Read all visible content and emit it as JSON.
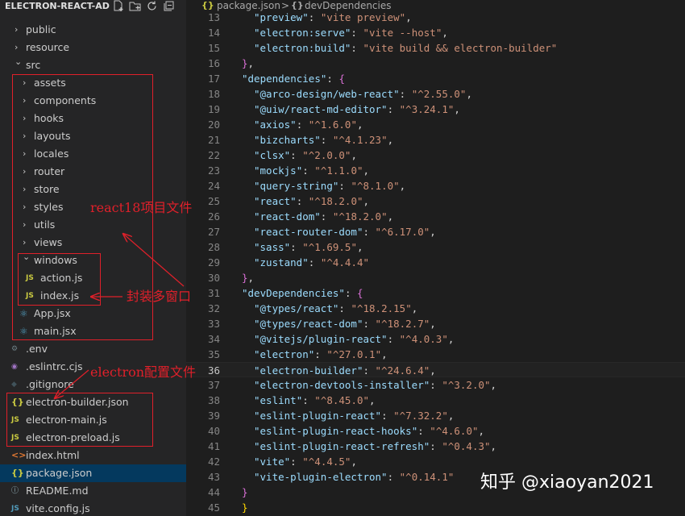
{
  "explorer": {
    "title": "ELECTRON-REACT-AD...",
    "actions": [
      {
        "name": "new-file-icon"
      },
      {
        "name": "new-folder-icon"
      },
      {
        "name": "refresh-icon"
      },
      {
        "name": "collapse-all-icon"
      }
    ],
    "tree": [
      {
        "label": "public",
        "type": "folder",
        "depth": 1,
        "expanded": false
      },
      {
        "label": "resource",
        "type": "folder",
        "depth": 1,
        "expanded": false
      },
      {
        "label": "src",
        "type": "folder",
        "depth": 1,
        "expanded": true
      },
      {
        "label": "assets",
        "type": "folder",
        "depth": 2,
        "expanded": false
      },
      {
        "label": "components",
        "type": "folder",
        "depth": 2,
        "expanded": false
      },
      {
        "label": "hooks",
        "type": "folder",
        "depth": 2,
        "expanded": false
      },
      {
        "label": "layouts",
        "type": "folder",
        "depth": 2,
        "expanded": false
      },
      {
        "label": "locales",
        "type": "folder",
        "depth": 2,
        "expanded": false
      },
      {
        "label": "router",
        "type": "folder",
        "depth": 2,
        "expanded": false
      },
      {
        "label": "store",
        "type": "folder",
        "depth": 2,
        "expanded": false
      },
      {
        "label": "styles",
        "type": "folder",
        "depth": 2,
        "expanded": false
      },
      {
        "label": "utils",
        "type": "folder",
        "depth": 2,
        "expanded": false
      },
      {
        "label": "views",
        "type": "folder",
        "depth": 2,
        "expanded": false
      },
      {
        "label": "windows",
        "type": "folder",
        "depth": 2,
        "expanded": true
      },
      {
        "label": "action.js",
        "type": "js",
        "icon": "JS",
        "depth": 3
      },
      {
        "label": "index.js",
        "type": "js",
        "icon": "JS",
        "depth": 3
      },
      {
        "label": "App.jsx",
        "type": "jsx",
        "icon": "⚛",
        "depth": 2
      },
      {
        "label": "main.jsx",
        "type": "jsx",
        "icon": "⚛",
        "depth": 2
      },
      {
        "label": ".env",
        "type": "env",
        "icon": "⚙",
        "depth": 1
      },
      {
        "label": ".eslintrc.cjs",
        "type": "eslint",
        "icon": "◉",
        "depth": 1
      },
      {
        "label": ".gitignore",
        "type": "git",
        "icon": "◆",
        "depth": 1
      },
      {
        "label": "electron-builder.json",
        "type": "json",
        "icon": "{}",
        "depth": 1
      },
      {
        "label": "electron-main.js",
        "type": "js",
        "icon": "JS",
        "depth": 1
      },
      {
        "label": "electron-preload.js",
        "type": "js",
        "icon": "JS",
        "depth": 1
      },
      {
        "label": "index.html",
        "type": "html",
        "icon": "<>",
        "depth": 1
      },
      {
        "label": "package.json",
        "type": "json",
        "icon": "{}",
        "depth": 1,
        "selected": true
      },
      {
        "label": "README.md",
        "type": "info",
        "icon": "ⓘ",
        "depth": 1
      },
      {
        "label": "vite.config.js",
        "type": "vite",
        "icon": "JS",
        "depth": 1
      }
    ]
  },
  "breadcrumb": {
    "icon": "{}",
    "file": "package.json",
    "separator": ">",
    "symbol_icon": "{}",
    "symbol": "devDependencies"
  },
  "editor": {
    "current_line": 36,
    "lines": [
      {
        "n": 13,
        "indent": 2,
        "key": "preview",
        "value": "vite preview",
        "tail": ","
      },
      {
        "n": 14,
        "indent": 2,
        "key": "electron:serve",
        "value": "vite --host",
        "tail": ","
      },
      {
        "n": 15,
        "indent": 2,
        "key": "electron:build",
        "value": "vite build && electron-builder",
        "tail": ""
      },
      {
        "n": 16,
        "indent": 1,
        "close": "}",
        "tail": ","
      },
      {
        "n": 17,
        "indent": 1,
        "key": "dependencies",
        "open": "{"
      },
      {
        "n": 18,
        "indent": 2,
        "key": "@arco-design/web-react",
        "value": "^2.55.0",
        "tail": ","
      },
      {
        "n": 19,
        "indent": 2,
        "key": "@uiw/react-md-editor",
        "value": "^3.24.1",
        "tail": ","
      },
      {
        "n": 20,
        "indent": 2,
        "key": "axios",
        "value": "^1.6.0",
        "tail": ","
      },
      {
        "n": 21,
        "indent": 2,
        "key": "bizcharts",
        "value": "^4.1.23",
        "tail": ","
      },
      {
        "n": 22,
        "indent": 2,
        "key": "clsx",
        "value": "^2.0.0",
        "tail": ","
      },
      {
        "n": 23,
        "indent": 2,
        "key": "mockjs",
        "value": "^1.1.0",
        "tail": ","
      },
      {
        "n": 24,
        "indent": 2,
        "key": "query-string",
        "value": "^8.1.0",
        "tail": ","
      },
      {
        "n": 25,
        "indent": 2,
        "key": "react",
        "value": "^18.2.0",
        "tail": ","
      },
      {
        "n": 26,
        "indent": 2,
        "key": "react-dom",
        "value": "^18.2.0",
        "tail": ","
      },
      {
        "n": 27,
        "indent": 2,
        "key": "react-router-dom",
        "value": "^6.17.0",
        "tail": ","
      },
      {
        "n": 28,
        "indent": 2,
        "key": "sass",
        "value": "^1.69.5",
        "tail": ","
      },
      {
        "n": 29,
        "indent": 2,
        "key": "zustand",
        "value": "^4.4.4",
        "tail": ""
      },
      {
        "n": 30,
        "indent": 1,
        "close": "}",
        "tail": ","
      },
      {
        "n": 31,
        "indent": 1,
        "key": "devDependencies",
        "open": "{"
      },
      {
        "n": 32,
        "indent": 2,
        "key": "@types/react",
        "value": "^18.2.15",
        "tail": ","
      },
      {
        "n": 33,
        "indent": 2,
        "key": "@types/react-dom",
        "value": "^18.2.7",
        "tail": ","
      },
      {
        "n": 34,
        "indent": 2,
        "key": "@vitejs/plugin-react",
        "value": "^4.0.3",
        "tail": ","
      },
      {
        "n": 35,
        "indent": 2,
        "key": "electron",
        "value": "^27.0.1",
        "tail": ","
      },
      {
        "n": 36,
        "indent": 2,
        "key": "electron-builder",
        "value": "^24.6.4",
        "tail": ","
      },
      {
        "n": 37,
        "indent": 2,
        "key": "electron-devtools-installer",
        "value": "^3.2.0",
        "tail": ","
      },
      {
        "n": 38,
        "indent": 2,
        "key": "eslint",
        "value": "^8.45.0",
        "tail": ","
      },
      {
        "n": 39,
        "indent": 2,
        "key": "eslint-plugin-react",
        "value": "^7.32.2",
        "tail": ","
      },
      {
        "n": 40,
        "indent": 2,
        "key": "eslint-plugin-react-hooks",
        "value": "^4.6.0",
        "tail": ","
      },
      {
        "n": 41,
        "indent": 2,
        "key": "eslint-plugin-react-refresh",
        "value": "^0.4.3",
        "tail": ","
      },
      {
        "n": 42,
        "indent": 2,
        "key": "vite",
        "value": "^4.4.5",
        "tail": ","
      },
      {
        "n": 43,
        "indent": 2,
        "key": "vite-plugin-electron",
        "value": "^0.14.1",
        "tail": ""
      },
      {
        "n": 44,
        "indent": 1,
        "close": "}",
        "tail": ""
      },
      {
        "n": 45,
        "indent": 0,
        "close": "}",
        "tail": ""
      }
    ]
  },
  "annotations": {
    "react_label": "react18项目文件",
    "window_label": "封装多窗口",
    "electron_label": "electron配置文件",
    "color": "#e0202a"
  },
  "watermark": "知乎 @xiaoyan2021"
}
